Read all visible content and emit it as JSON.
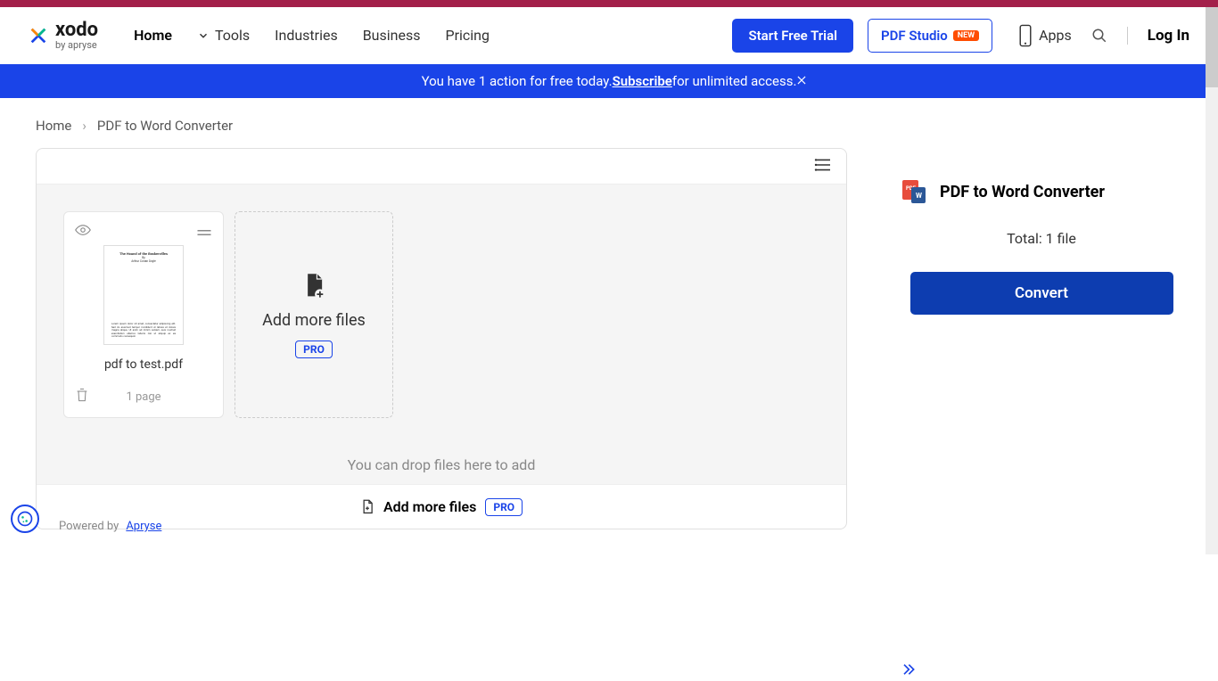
{
  "brand": {
    "name": "xodo",
    "sub": "by apryse"
  },
  "nav": {
    "home": "Home",
    "tools": "Tools",
    "industries": "Industries",
    "business": "Business",
    "pricing": "Pricing"
  },
  "header_buttons": {
    "trial": "Start Free Trial",
    "pdf_studio": "PDF Studio",
    "new_badge": "NEW",
    "apps": "Apps",
    "login": "Log In"
  },
  "banner": {
    "prefix": "You have 1 action for free today. ",
    "link": "Subscribe",
    "suffix": " for unlimited access."
  },
  "breadcrumb": {
    "home": "Home",
    "current": "PDF to Word Converter"
  },
  "file": {
    "name": "pdf to test.pdf",
    "pages": "1 page",
    "preview_title": "The Hound of the Baskervilles",
    "preview_author": "By",
    "preview_author2": "Arthur Conan Doyle"
  },
  "add_more": {
    "label": "Add more files",
    "pro": "PRO"
  },
  "drop_hint": "You can drop files here to add",
  "bottom_add": {
    "label": "Add more files",
    "pro": "PRO"
  },
  "side": {
    "title": "PDF to Word Converter",
    "total": "Total: 1 file",
    "convert": "Convert"
  },
  "footer": {
    "powered": "Powered by",
    "brand": "Apryse"
  }
}
